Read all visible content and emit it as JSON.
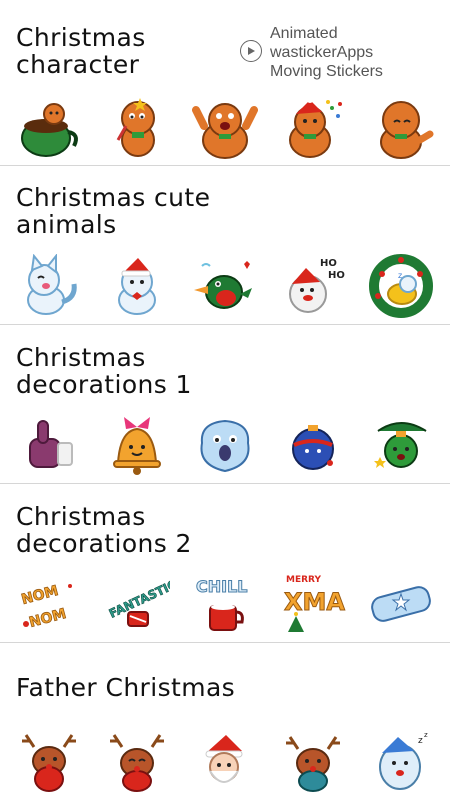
{
  "badge": {
    "icon": "play-circle-icon",
    "lines": [
      "Animated",
      "wastickerApps",
      "Moving Stickers"
    ]
  },
  "packs": [
    {
      "title_line1": "Christmas",
      "title_line2": "character",
      "stickers": [
        "gingerbread-cup-sticker",
        "gingerbread-wand-sticker",
        "gingerbread-cheer-sticker",
        "gingerbread-party-sticker",
        "gingerbread-wave-sticker"
      ]
    },
    {
      "title_line1": "Christmas cute",
      "title_line2": "animals",
      "stickers": [
        "white-fox-sticker",
        "fox-santa-hat-sticker",
        "green-bird-sticker",
        "santa-ho-ho-sticker",
        "wreath-animal-sticker"
      ]
    },
    {
      "title_line1": "Christmas",
      "title_line2": "decorations 1",
      "stickers": [
        "thumbs-up-mitten-sticker",
        "bell-bow-sticker",
        "snowball-face-sticker",
        "ornament-ball-sticker",
        "tree-ornament-sticker"
      ]
    },
    {
      "title_line1": "Christmas",
      "title_line2": "decorations 2",
      "stickers": [
        "nom-nom-sticker",
        "fantastic-drum-sticker",
        "chill-mug-sticker",
        "merry-xmas-sticker",
        "frosty-text-sticker"
      ],
      "sticker_text": {
        "nom": "NOM NOM",
        "fantastic": "FANTASTIC!",
        "chill": "CHILL",
        "xmas": "XMAS",
        "merry": "MERRY"
      }
    },
    {
      "title_line1": "Father Christmas",
      "title_line2": "",
      "stickers": [
        "reindeer-one-sticker",
        "reindeer-two-sticker",
        "santa-face-sticker",
        "reindeer-three-sticker",
        "snowy-santa-sticker"
      ]
    }
  ]
}
